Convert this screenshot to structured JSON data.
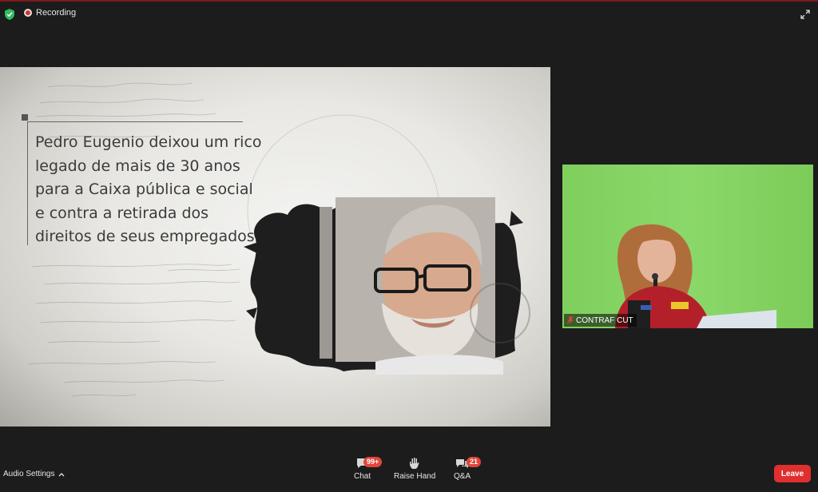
{
  "header": {
    "recording_label": "Recording"
  },
  "slide": {
    "text": "Pedro Eugenio deixou um rico legado de mais de 30 anos para a Caixa pública e social e contra a retirada dos direitos de seus empregados."
  },
  "participant": {
    "name": "CONTRAF CUT"
  },
  "toolbar": {
    "audio_settings_label": "Audio Settings",
    "chat_label": "Chat",
    "chat_badge": "99+",
    "raise_hand_label": "Raise Hand",
    "qa_label": "Q&A",
    "qa_badge": "21",
    "leave_label": "Leave"
  },
  "colors": {
    "leave": "#e02f2f",
    "badge": "#e0463b",
    "shield": "#2fbd5f",
    "recording": "#d9332b"
  }
}
